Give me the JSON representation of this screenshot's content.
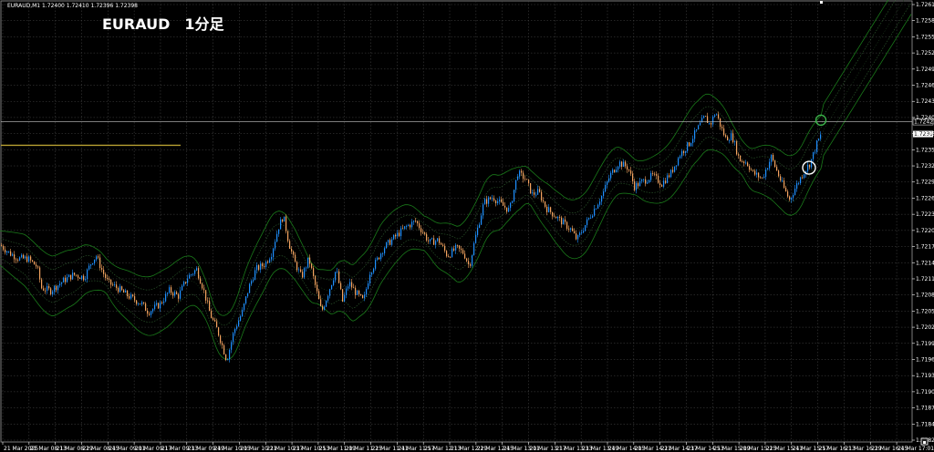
{
  "window": {
    "symbol_header": "EURAUD,M1  1.72400 1.72410 1.72396 1.72398",
    "overlay_title": "EURAUD　1分足",
    "current_price_label": "1.72398",
    "horizontal_line_label": "1.72421"
  },
  "colors": {
    "background": "#000000",
    "grid": "#4a4a4a",
    "bull": "#1e90ff",
    "bear": "#f4a460",
    "bands": "#1a7a1a",
    "bands_mid": "#2f5f2f",
    "hline": "#c8c8c8",
    "gold_line": "#b8a032",
    "circle_green": "#3cb44b",
    "circle_white": "#ffffff",
    "text": "#ffffff"
  },
  "chart_data": {
    "type": "candlestick",
    "symbol": "EURAUD",
    "timeframe": "M1",
    "ylim": [
      1.71822,
      1.72647
    ],
    "y_ticks": [
      "1.72617",
      "1.72587",
      "1.72557",
      "1.72527",
      "1.72497",
      "1.72467",
      "1.72437",
      "1.72407",
      "1.72382",
      "1.72352",
      "1.72322",
      "1.72292",
      "1.72262",
      "1.72232",
      "1.72202",
      "1.72172",
      "1.72142",
      "1.72112",
      "1.72087",
      "1.72057",
      "1.72027",
      "1.71997",
      "1.71967",
      "1.71937",
      "1.71907",
      "1.71877",
      "1.71847",
      "1.71822"
    ],
    "x_ticks": [
      "21 Mar 2025",
      "21 Mar 08:13",
      "21 Mar 08:29",
      "21 Mar 08:45",
      "21 Mar 09:01",
      "21 Mar 09:17",
      "21 Mar 09:33",
      "21 Mar 09:49",
      "21 Mar 10:05",
      "21 Mar 10:21",
      "21 Mar 10:37",
      "21 Mar 10:53",
      "21 Mar 11:09",
      "21 Mar 11:25",
      "21 Mar 11:41",
      "21 Mar 11:57",
      "21 Mar 12:13",
      "21 Mar 12:29",
      "21 Mar 12:45",
      "21 Mar 13:01",
      "21 Mar 13:17",
      "21 Mar 13:33",
      "21 Mar 13:49",
      "21 Mar 14:05",
      "21 Mar 14:21",
      "21 Mar 14:37",
      "21 Mar 14:53",
      "21 Mar 15:09",
      "21 Mar 15:25",
      "21 Mar 15:41",
      "21 Mar 15:57",
      "21 Mar 16:13",
      "21 Mar 16:29",
      "21 Mar 16:45",
      "21 Mar 17:01"
    ],
    "path_points": [
      [
        0,
        1.7219
      ],
      [
        10,
        1.72175
      ],
      [
        20,
        1.72165
      ],
      [
        30,
        1.72165
      ],
      [
        40,
        1.7215
      ],
      [
        45,
        1.7211
      ],
      [
        55,
        1.72105
      ],
      [
        70,
        1.72125
      ],
      [
        80,
        1.72135
      ],
      [
        92,
        1.7213
      ],
      [
        100,
        1.7216
      ],
      [
        105,
        1.7217
      ],
      [
        112,
        1.7214
      ],
      [
        118,
        1.7212
      ],
      [
        128,
        1.7211
      ],
      [
        140,
        1.72095
      ],
      [
        155,
        1.7208
      ],
      [
        162,
        1.72065
      ],
      [
        175,
        1.7208
      ],
      [
        185,
        1.72105
      ],
      [
        195,
        1.72095
      ],
      [
        205,
        1.7213
      ],
      [
        215,
        1.72145
      ],
      [
        222,
        1.7211
      ],
      [
        230,
        1.7206
      ],
      [
        238,
        1.7203
      ],
      [
        248,
        1.71975
      ],
      [
        256,
        1.7203
      ],
      [
        265,
        1.72065
      ],
      [
        272,
        1.7211
      ],
      [
        280,
        1.72145
      ],
      [
        290,
        1.72155
      ],
      [
        297,
        1.72175
      ],
      [
        305,
        1.72225
      ],
      [
        310,
        1.72245
      ],
      [
        316,
        1.72195
      ],
      [
        322,
        1.7216
      ],
      [
        330,
        1.7213
      ],
      [
        338,
        1.72165
      ],
      [
        345,
        1.72115
      ],
      [
        352,
        1.72065
      ],
      [
        360,
        1.72105
      ],
      [
        368,
        1.72145
      ],
      [
        375,
        1.72085
      ],
      [
        382,
        1.7212
      ],
      [
        390,
        1.721
      ],
      [
        398,
        1.72085
      ],
      [
        405,
        1.7214
      ],
      [
        412,
        1.7216
      ],
      [
        420,
        1.72185
      ],
      [
        432,
        1.72205
      ],
      [
        445,
        1.72225
      ],
      [
        455,
        1.72235
      ],
      [
        463,
        1.72215
      ],
      [
        470,
        1.72195
      ],
      [
        480,
        1.722
      ],
      [
        490,
        1.7217
      ],
      [
        500,
        1.72185
      ],
      [
        508,
        1.72175
      ],
      [
        514,
        1.7215
      ],
      [
        520,
        1.722
      ],
      [
        530,
        1.7227
      ],
      [
        540,
        1.7228
      ],
      [
        550,
        1.72265
      ],
      [
        558,
        1.72255
      ],
      [
        567,
        1.72325
      ],
      [
        575,
        1.72315
      ],
      [
        583,
        1.72285
      ],
      [
        590,
        1.7229
      ],
      [
        598,
        1.7226
      ],
      [
        608,
        1.72245
      ],
      [
        618,
        1.7223
      ],
      [
        625,
        1.7222
      ],
      [
        632,
        1.722
      ],
      [
        640,
        1.72225
      ],
      [
        650,
        1.72255
      ],
      [
        660,
        1.72285
      ],
      [
        668,
        1.7232
      ],
      [
        678,
        1.72345
      ],
      [
        688,
        1.72335
      ],
      [
        695,
        1.723
      ],
      [
        705,
        1.7231
      ],
      [
        715,
        1.7232
      ],
      [
        725,
        1.72305
      ],
      [
        735,
        1.72325
      ],
      [
        745,
        1.7236
      ],
      [
        755,
        1.7238
      ],
      [
        765,
        1.7241
      ],
      [
        772,
        1.7243
      ],
      [
        778,
        1.72415
      ],
      [
        784,
        1.7244
      ],
      [
        790,
        1.7241
      ],
      [
        795,
        1.7239
      ],
      [
        802,
        1.72395
      ],
      [
        810,
        1.7235
      ],
      [
        818,
        1.72345
      ],
      [
        825,
        1.72325
      ],
      [
        835,
        1.72315
      ],
      [
        845,
        1.72355
      ],
      [
        852,
        1.72325
      ],
      [
        858,
        1.723
      ],
      [
        865,
        1.72275
      ],
      [
        872,
        1.723
      ],
      [
        880,
        1.72325
      ],
      [
        888,
        1.72345
      ],
      [
        895,
        1.7238
      ],
      [
        900,
        1.72398
      ]
    ],
    "horizontal_line": 1.72421,
    "current_price": 1.72398,
    "bands": {
      "upper_offset": 0.0004,
      "mid_offset": 0.0002
    },
    "gold_line": {
      "x_start": 1,
      "x_end": 198,
      "value": 1.72377
    },
    "markers": [
      {
        "type": "circle",
        "color": "green",
        "x": 900,
        "value": 1.72424
      },
      {
        "type": "circle",
        "color": "white",
        "x": 887,
        "value": 1.72335
      }
    ]
  }
}
